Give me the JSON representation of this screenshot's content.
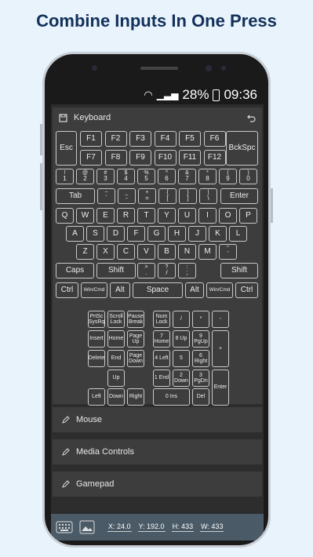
{
  "headline": "Combine Inputs In One Press",
  "status": {
    "battery": "28%",
    "time": "09:36"
  },
  "keyboard_panel": {
    "title": "Keyboard"
  },
  "keys": {
    "fn_row": [
      "Esc",
      "F1",
      "F2",
      "F3",
      "F4",
      "F5",
      "F6",
      "BckSpc",
      "F7",
      "F8",
      "F9",
      "F10",
      "F11",
      "F12"
    ],
    "num_row": [
      [
        "!",
        "1"
      ],
      [
        "@",
        "2"
      ],
      [
        "#",
        "3"
      ],
      [
        "$",
        "4"
      ],
      [
        "%",
        "5"
      ],
      [
        "^",
        "6"
      ],
      [
        "&",
        "7"
      ],
      [
        "*",
        "8"
      ],
      [
        "(",
        "9"
      ],
      [
        ")",
        "0"
      ]
    ],
    "tab_row": [
      "Tab",
      [
        "~",
        "`"
      ],
      [
        "_",
        "-"
      ],
      [
        "+",
        "="
      ],
      [
        "{",
        "["
      ],
      [
        "}",
        "]"
      ],
      [
        "|",
        "\\"
      ],
      "Enter"
    ],
    "row_q": [
      "Q",
      "W",
      "E",
      "R",
      "T",
      "Y",
      "U",
      "I",
      "O",
      "P"
    ],
    "row_a": [
      "A",
      "S",
      "D",
      "F",
      "G",
      "H",
      "J",
      "K",
      "L"
    ],
    "row_z": [
      "Z",
      "X",
      "C",
      "V",
      "B",
      "N",
      "M",
      [
        "\"",
        "'"
      ]
    ],
    "shift_row": [
      "Caps",
      "Shift",
      [
        ">",
        "."
      ],
      [
        "?",
        "/"
      ],
      [
        ":",
        ";"
      ],
      "Shift"
    ],
    "ctrl_row": [
      "Ctrl",
      "Win/Cmd",
      "Alt",
      "Space",
      "Alt",
      "Win/Cmd",
      "Ctrl"
    ],
    "nav": [
      "PrtSc SysRq",
      "Scroll Lock",
      "Pause Break",
      "Insert",
      "Home",
      "Page Up",
      "Delete",
      "End",
      "Page Down",
      "Up",
      "Left",
      "Down",
      "Right"
    ],
    "numpad": [
      "Num Lock",
      "/",
      "*",
      "-",
      "7 Home",
      "8 Up",
      "9 PgUp",
      "+",
      "4 Left",
      "5",
      "6 Right",
      "1 End",
      "2 Down",
      "3 PgDn",
      "Enter",
      "0 Ins",
      "Del"
    ]
  },
  "sections": [
    "Mouse",
    "Media Controls",
    "Gamepad"
  ],
  "bottom": {
    "x": "X: 24.0",
    "y": "Y: 192.0",
    "h": "H: 433",
    "w": "W: 433"
  }
}
